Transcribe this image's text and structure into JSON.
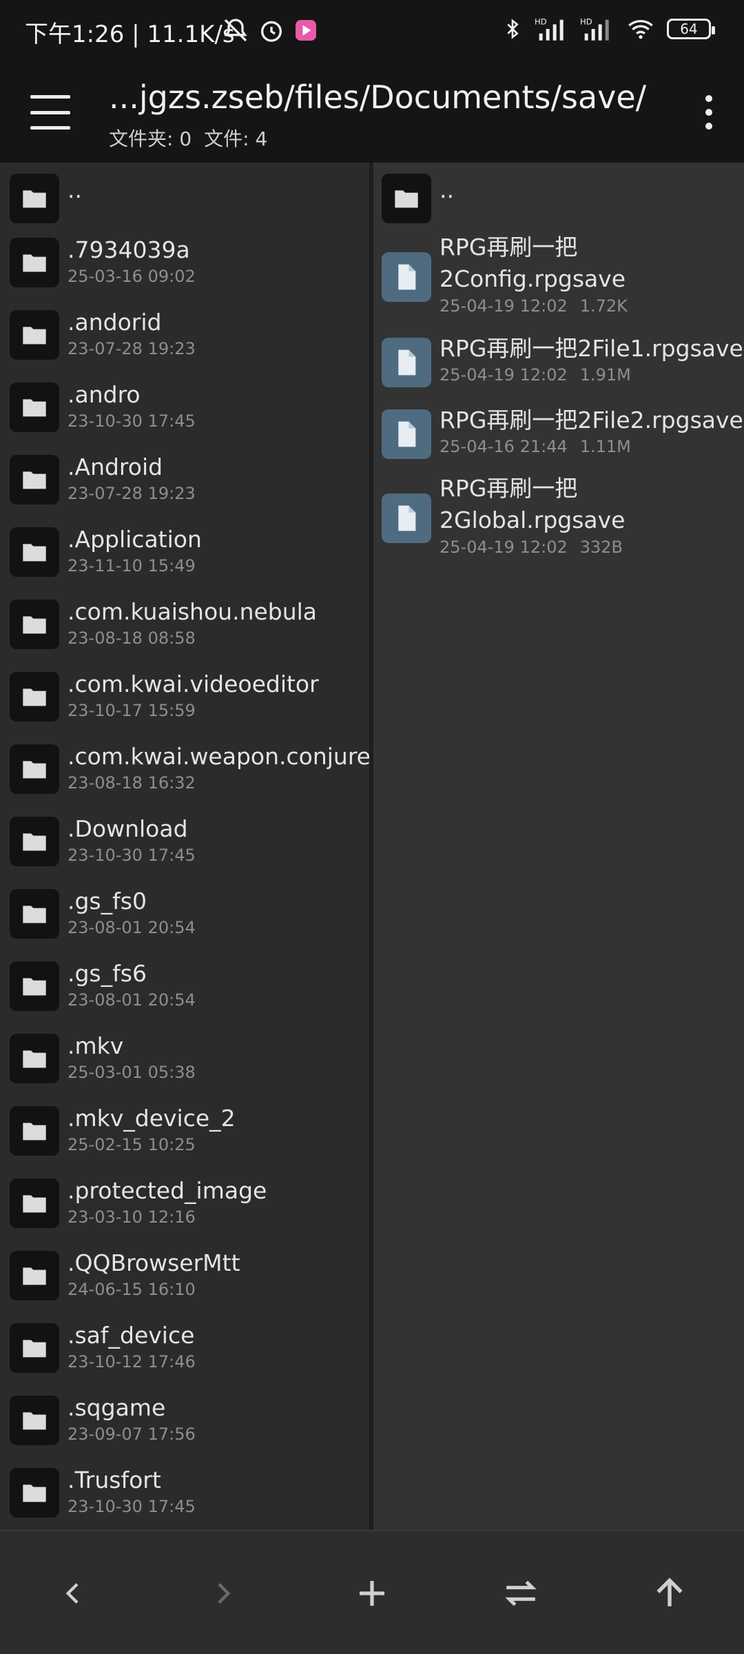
{
  "status_bar": {
    "time": "下午1:26 | 11.1K/s",
    "battery": "64"
  },
  "toolbar": {
    "path": "...jgzs.zseb/files/Documents/save/",
    "folders": "文件夹: 0",
    "files": "文件: 4"
  },
  "left_pane": {
    "parent": "..",
    "items": [
      {
        "name": ".7934039a",
        "date": "25-03-16 09:02"
      },
      {
        "name": ".andorid",
        "date": "23-07-28 19:23"
      },
      {
        "name": ".andro",
        "date": "23-10-30 17:45"
      },
      {
        "name": ".Android",
        "date": "23-07-28 19:23"
      },
      {
        "name": ".Application",
        "date": "23-11-10 15:49"
      },
      {
        "name": ".com.kuaishou.nebula",
        "date": "23-08-18 08:58"
      },
      {
        "name": ".com.kwai.videoeditor",
        "date": "23-10-17 15:59"
      },
      {
        "name": ".com.kwai.weapon.conjure",
        "date": "23-08-18 16:32"
      },
      {
        "name": ".Download",
        "date": "23-10-30 17:45"
      },
      {
        "name": ".gs_fs0",
        "date": "23-08-01 20:54"
      },
      {
        "name": ".gs_fs6",
        "date": "23-08-01 20:54"
      },
      {
        "name": ".mkv",
        "date": "25-03-01 05:38"
      },
      {
        "name": ".mkv_device_2",
        "date": "25-02-15 10:25"
      },
      {
        "name": ".protected_image",
        "date": "23-03-10 12:16"
      },
      {
        "name": ".QQBrowserMtt",
        "date": "24-06-15 16:10"
      },
      {
        "name": ".saf_device",
        "date": "23-10-12 17:46"
      },
      {
        "name": ".sqgame",
        "date": "23-09-07 17:56"
      },
      {
        "name": ".Trusfort",
        "date": "23-10-30 17:45"
      }
    ]
  },
  "right_pane": {
    "parent": "..",
    "items": [
      {
        "name": "RPG再刷一把2Config.rpgsave",
        "date": "25-04-19 12:02",
        "size": "1.72K"
      },
      {
        "name": "RPG再刷一把2File1.rpgsave",
        "date": "25-04-19 12:02",
        "size": "1.91M"
      },
      {
        "name": "RPG再刷一把2File2.rpgsave",
        "date": "25-04-16 21:44",
        "size": "1.11M"
      },
      {
        "name": "RPG再刷一把2Global.rpgsave",
        "date": "25-04-19 12:02",
        "size": "332B"
      }
    ]
  },
  "bottom_nav": {
    "buttons": [
      "back-icon",
      "forward-icon",
      "add-icon",
      "swap-icon",
      "up-icon"
    ]
  },
  "colors": {
    "toolbar_bg": "#151515",
    "left_pane_bg": "#2b2b2b",
    "right_pane_bg": "#333333",
    "file_icon_bg": "#4f6b80"
  }
}
